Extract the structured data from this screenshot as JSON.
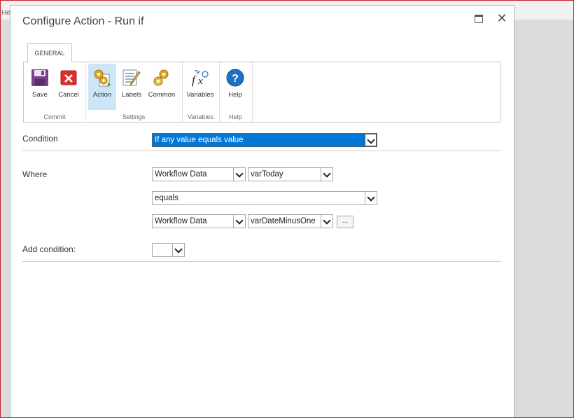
{
  "background": {
    "tab_fragment": "He"
  },
  "dialog": {
    "title": "Configure Action - Run if"
  },
  "ribbon": {
    "tab_label": "GENERAL",
    "groups": [
      {
        "label": "Commit",
        "buttons": [
          {
            "label": "Save",
            "icon": "save-icon"
          },
          {
            "label": "Cancel",
            "icon": "cancel-icon"
          }
        ]
      },
      {
        "label": "Settings",
        "buttons": [
          {
            "label": "Action",
            "icon": "action-icon"
          },
          {
            "label": "Labels",
            "icon": "labels-icon"
          },
          {
            "label": "Common",
            "icon": "common-icon"
          }
        ]
      },
      {
        "label": "Variables",
        "buttons": [
          {
            "label": "Variables",
            "icon": "variables-icon"
          }
        ]
      },
      {
        "label": "Help",
        "buttons": [
          {
            "label": "Help",
            "icon": "help-icon"
          }
        ]
      }
    ]
  },
  "form": {
    "condition_label": "Condition",
    "condition_value": "If any value equals value",
    "where_label": "Where",
    "left_source": "Workflow Data",
    "left_variable": "varToday",
    "operator": "equals",
    "right_source": "Workflow Data",
    "right_variable": "varDateMinusOne",
    "ellipsis_label": "...",
    "add_condition_label": "Add condition:",
    "add_condition_value": ""
  },
  "colors": {
    "highlight": "#0078d7",
    "active_button": "#cde6f7",
    "frame_border": "#c8202f"
  }
}
